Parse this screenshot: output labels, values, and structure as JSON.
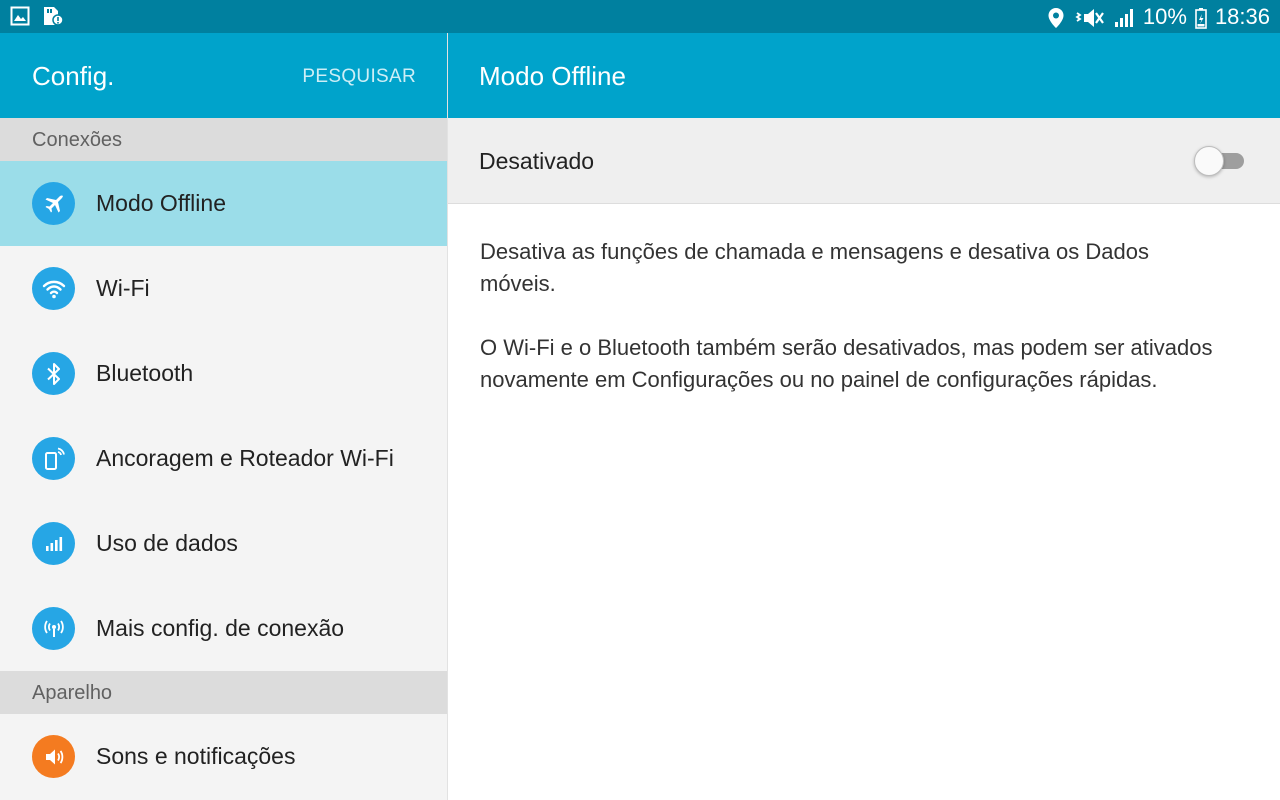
{
  "status_bar": {
    "left_icons": [
      "image-icon",
      "sd-card-icon"
    ],
    "right_icons": [
      "location-icon",
      "vibrate-icon",
      "signal-icon",
      "battery-icon"
    ],
    "battery": "10%",
    "time": "18:36"
  },
  "sidebar": {
    "title": "Config.",
    "search_label": "PESQUISAR",
    "sections": [
      {
        "label": "Conexões"
      },
      {
        "label": "Aparelho"
      }
    ],
    "items": [
      {
        "label": "Modo Offline",
        "icon": "airplane-icon",
        "selected": true
      },
      {
        "label": "Wi-Fi",
        "icon": "wifi-icon"
      },
      {
        "label": "Bluetooth",
        "icon": "bluetooth-icon"
      },
      {
        "label": "Ancoragem e Roteador Wi-Fi",
        "icon": "tethering-icon"
      },
      {
        "label": "Uso de dados",
        "icon": "data-usage-icon"
      },
      {
        "label": "Mais config. de conexão",
        "icon": "more-connection-icon"
      },
      {
        "label": "Sons e notificações",
        "icon": "sound-icon"
      }
    ]
  },
  "main": {
    "title": "Modo Offline",
    "toggle": {
      "label": "Desativado",
      "on": false
    },
    "description": [
      "Desativa as funções de chamada e mensagens e desativa os Dados móveis.",
      "O Wi-Fi e o Bluetooth também serão desativados, mas podem ser ativados novamente em Configurações ou no painel de configurações rápidas."
    ]
  },
  "colors": {
    "status_bar": "#00809f",
    "header": "#00a3cb",
    "selected_item": "#9bdde9",
    "icon_blue": "#26a6e5",
    "icon_orange": "#f47b20"
  }
}
